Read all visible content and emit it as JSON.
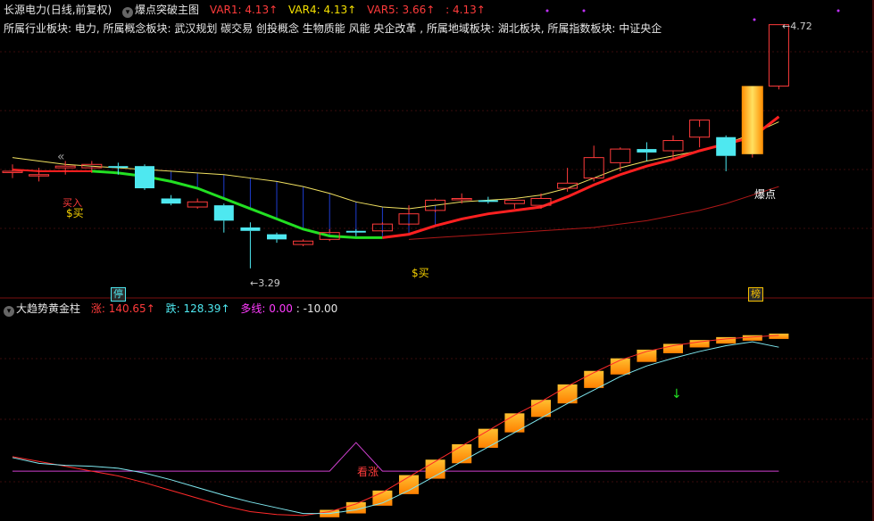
{
  "header": {
    "stock_name": "长源电力",
    "period": "(日线,前复权)",
    "indicator_title": "爆点突破主图",
    "var1": "VAR1: 4.13",
    "var4": "VAR4: 4.13",
    "var5": "VAR5: 3.66",
    "extra": ": 4.13"
  },
  "sectors": "所属行业板块: 电力, 所属概念板块: 武汉规划 碳交易 创投概念 生物质能 风能 央企改革 , 所属地域板块: 湖北板块, 所属指数板块: 中证央企",
  "sub_header": {
    "title": "大趋势黄金柱",
    "zhang": "涨: 140.65",
    "die": "跌: 128.39",
    "duoxian": "多线: 0.00",
    "extra": ": -10.00"
  },
  "annotations": {
    "buy1": "$买",
    "buy2": "$买",
    "buy_partial": "买入",
    "low_price": "3.29",
    "high_price": "4.72",
    "baodian": "爆点",
    "ting": "停",
    "bang": "榜",
    "kanzhang": "看涨",
    "collapse": "«"
  },
  "colors": {
    "up": "#ff3b3b",
    "down": "#4ee8f0",
    "ma_yellow": "#f0e060",
    "ma_green": "#22e022",
    "ma_red": "#ff2020",
    "ma_darkred": "#b01818",
    "bar_gold": "#ffaa00",
    "magenta": "#d040d0"
  },
  "chart_data": {
    "type": "candlestick",
    "price_range": [
      3.2,
      4.76
    ],
    "candles": [
      {
        "o": 3.86,
        "h": 3.9,
        "l": 3.82,
        "c": 3.86
      },
      {
        "o": 3.84,
        "h": 3.88,
        "l": 3.8,
        "c": 3.84
      },
      {
        "o": 3.88,
        "h": 3.92,
        "l": 3.84,
        "c": 3.89
      },
      {
        "o": 3.88,
        "h": 3.92,
        "l": 3.85,
        "c": 3.9
      },
      {
        "o": 3.89,
        "h": 3.91,
        "l": 3.84,
        "c": 3.88
      },
      {
        "o": 3.89,
        "h": 3.9,
        "l": 3.75,
        "c": 3.76
      },
      {
        "o": 3.7,
        "h": 3.72,
        "l": 3.66,
        "c": 3.67
      },
      {
        "o": 3.65,
        "h": 3.7,
        "l": 3.64,
        "c": 3.68
      },
      {
        "o": 3.66,
        "h": 3.67,
        "l": 3.5,
        "c": 3.57
      },
      {
        "o": 3.53,
        "h": 3.56,
        "l": 3.29,
        "c": 3.51
      },
      {
        "o": 3.49,
        "h": 3.5,
        "l": 3.44,
        "c": 3.46
      },
      {
        "o": 3.43,
        "h": 3.46,
        "l": 3.42,
        "c": 3.45
      },
      {
        "o": 3.46,
        "h": 3.52,
        "l": 3.45,
        "c": 3.5
      },
      {
        "o": 3.51,
        "h": 3.52,
        "l": 3.48,
        "c": 3.5
      },
      {
        "o": 3.51,
        "h": 3.56,
        "l": 3.5,
        "c": 3.55
      },
      {
        "o": 3.55,
        "h": 3.66,
        "l": 3.54,
        "c": 3.61
      },
      {
        "o": 3.63,
        "h": 3.7,
        "l": 3.62,
        "c": 3.69
      },
      {
        "o": 3.7,
        "h": 3.73,
        "l": 3.67,
        "c": 3.7
      },
      {
        "o": 3.69,
        "h": 3.71,
        "l": 3.67,
        "c": 3.68
      },
      {
        "o": 3.67,
        "h": 3.69,
        "l": 3.64,
        "c": 3.69
      },
      {
        "o": 3.66,
        "h": 3.73,
        "l": 3.64,
        "c": 3.7
      },
      {
        "o": 3.76,
        "h": 3.88,
        "l": 3.74,
        "c": 3.79
      },
      {
        "o": 3.82,
        "h": 4.01,
        "l": 3.8,
        "c": 3.94
      },
      {
        "o": 3.91,
        "h": 4.0,
        "l": 3.86,
        "c": 3.99
      },
      {
        "o": 3.99,
        "h": 4.03,
        "l": 3.92,
        "c": 3.97
      },
      {
        "o": 3.98,
        "h": 4.07,
        "l": 3.93,
        "c": 4.04
      },
      {
        "o": 4.06,
        "h": 4.12,
        "l": 4.0,
        "c": 4.16
      },
      {
        "o": 4.06,
        "h": 4.07,
        "l": 3.86,
        "c": 3.95
      },
      {
        "o": 3.96,
        "h": 4.36,
        "l": 3.94,
        "c": 4.36
      },
      {
        "o": 4.36,
        "h": 4.72,
        "l": 4.34,
        "c": 4.72
      }
    ],
    "ma_yellow": [
      3.94,
      3.92,
      3.9,
      3.89,
      3.88,
      3.87,
      3.86,
      3.85,
      3.84,
      3.82,
      3.8,
      3.77,
      3.73,
      3.68,
      3.65,
      3.64,
      3.66,
      3.68,
      3.69,
      3.7,
      3.72,
      3.76,
      3.82,
      3.88,
      3.92,
      3.95,
      3.98,
      4.02,
      4.08,
      4.15
    ],
    "ma_fast": [
      3.87,
      3.86,
      3.86,
      3.86,
      3.85,
      3.83,
      3.8,
      3.76,
      3.7,
      3.64,
      3.58,
      3.52,
      3.48,
      3.47,
      3.47,
      3.49,
      3.54,
      3.58,
      3.61,
      3.63,
      3.65,
      3.71,
      3.78,
      3.84,
      3.89,
      3.93,
      3.98,
      4.02,
      4.06,
      4.18
    ],
    "ma_slow": [
      null,
      null,
      null,
      null,
      null,
      null,
      null,
      null,
      null,
      null,
      null,
      null,
      null,
      null,
      null,
      3.46,
      3.47,
      3.48,
      3.49,
      3.5,
      3.51,
      3.52,
      3.53,
      3.55,
      3.57,
      3.6,
      3.63,
      3.67,
      3.72,
      3.77
    ],
    "sub": {
      "range": [
        -10,
        160
      ],
      "zhang": [
        15,
        10,
        5,
        0,
        -5,
        -12,
        -20,
        -28,
        -36,
        -42,
        -45,
        -46,
        -42,
        -34,
        -22,
        -6,
        10,
        26,
        42,
        58,
        72,
        88,
        102,
        115,
        124,
        130,
        134,
        137,
        139,
        140.65
      ],
      "die": [
        14,
        8,
        6,
        5,
        3,
        -2,
        -9,
        -17,
        -25,
        -32,
        -38,
        -44,
        -44,
        -40,
        -33,
        -20,
        -5,
        10,
        25,
        40,
        55,
        70,
        84,
        98,
        109,
        117,
        124,
        130,
        134,
        128.39
      ],
      "gold_bars_from": 12,
      "duoxian_peak_index": 13
    }
  }
}
